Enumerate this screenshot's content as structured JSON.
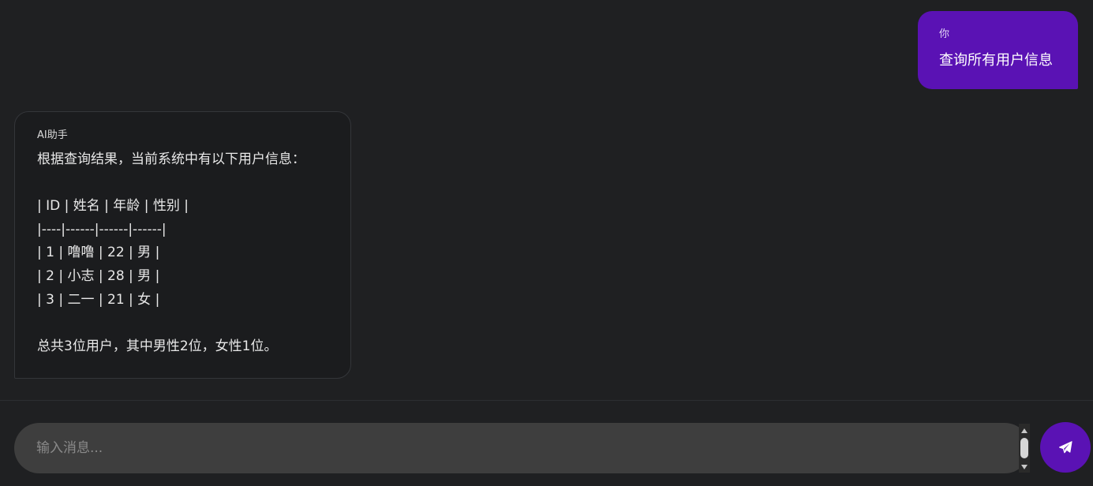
{
  "conversation": {
    "messages": [
      {
        "role": "user",
        "sender": "你",
        "text": "查询所有用户信息"
      },
      {
        "role": "assistant",
        "sender": "AI助手",
        "text": "根据查询结果，当前系统中有以下用户信息：\n\n| ID | 姓名 | 年龄 | 性别 |\n|----|------|------|------|\n| 1 | 噜噜 | 22 | 男 |\n| 2 | 小志 | 28 | 男 |\n| 3 | 二一 | 21 | 女 |\n\n总共3位用户，其中男性2位，女性1位。"
      }
    ]
  },
  "composer": {
    "placeholder": "输入消息...",
    "value": "",
    "send_icon": "paper-plane-icon"
  },
  "colors": {
    "background": "#1f2022",
    "user_bubble": "#5a12b4",
    "ai_bubble": "#1b1c1e",
    "input_background": "#3e3e3e",
    "accent": "#5a12b4"
  }
}
